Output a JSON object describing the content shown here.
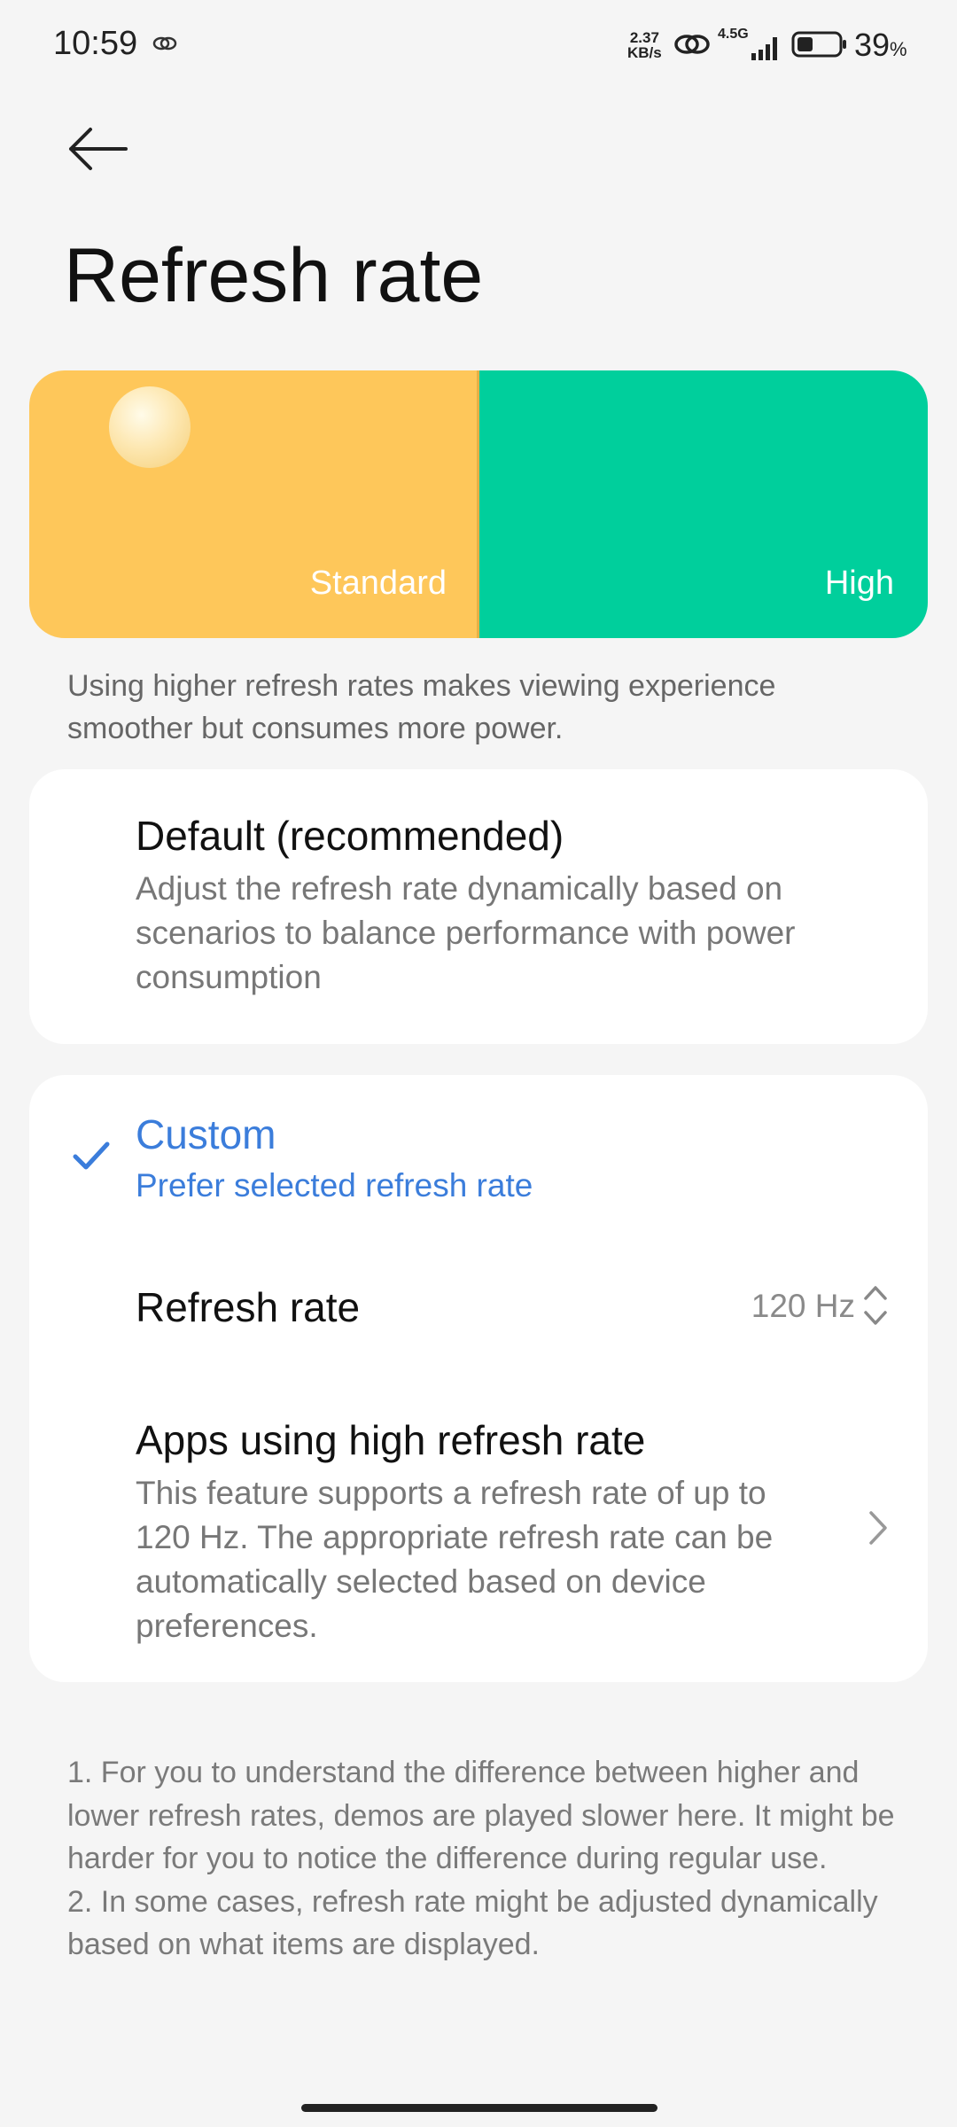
{
  "status_bar": {
    "time": "10:59",
    "speed_value": "2.37",
    "speed_unit": "KB/s",
    "network": "4.5G",
    "battery_percent": "39",
    "battery_unit": "%",
    "battery_level": 0.39
  },
  "header": {
    "title": "Refresh rate"
  },
  "demo": {
    "standard_label": "Standard",
    "high_label": "High",
    "standard_color": "#fec75a",
    "high_color": "#00cf9c"
  },
  "intro_text": "Using higher refresh rates makes viewing experience smoother but consumes more power.",
  "options": {
    "default": {
      "title": "Default (recommended)",
      "description": "Adjust the refresh rate dynamically based on scenarios to balance performance with power consumption"
    },
    "custom": {
      "title": "Custom",
      "description": "Prefer selected refresh rate",
      "selected": true,
      "accent_color": "#3b7ddb"
    }
  },
  "refresh_rate_row": {
    "label": "Refresh rate",
    "value": "120 Hz"
  },
  "apps_row": {
    "title": "Apps using high refresh rate",
    "description": "This feature supports a refresh rate of up to 120 Hz. The appropriate refresh rate can be automatically selected based on device preferences."
  },
  "footnotes": [
    "1. For you to understand the difference between higher and lower refresh rates, demos are played slower here. It might be harder for you to notice the difference during regular use.",
    "2. In some cases, refresh rate might be adjusted dynamically based on what items are displayed."
  ],
  "icons": {
    "back": "back-arrow-icon",
    "check": "checkmark-icon",
    "updown": "up-down-chevron-icon",
    "chevron": "chevron-right-icon"
  }
}
